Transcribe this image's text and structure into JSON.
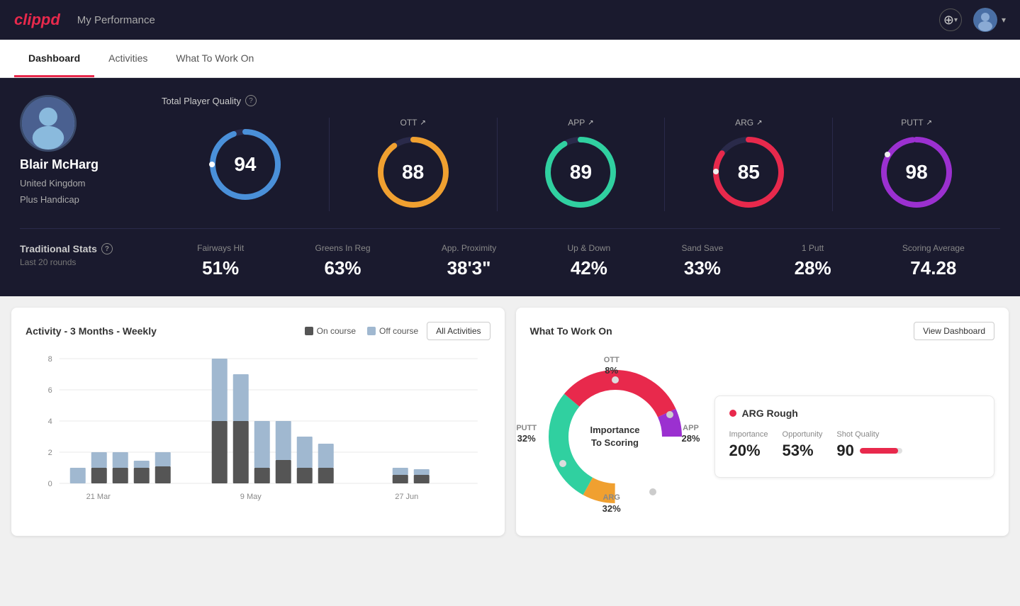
{
  "header": {
    "logo": "clippd",
    "title": "My Performance",
    "add_icon": "⊕",
    "chevron": "▾",
    "user_chevron": "▾"
  },
  "nav": {
    "tabs": [
      {
        "label": "Dashboard",
        "active": true
      },
      {
        "label": "Activities",
        "active": false
      },
      {
        "label": "What To Work On",
        "active": false
      }
    ]
  },
  "player": {
    "name": "Blair McHarg",
    "country": "United Kingdom",
    "handicap": "Plus Handicap"
  },
  "quality": {
    "section_label": "Total Player Quality",
    "total": {
      "value": "94",
      "color_start": "#4a90d9",
      "color_end": "#2a70b9"
    },
    "ott": {
      "label": "OTT",
      "value": "88",
      "color": "#f0a030"
    },
    "app": {
      "label": "APP",
      "value": "89",
      "color": "#30d0a0"
    },
    "arg": {
      "label": "ARG",
      "value": "85",
      "color": "#e8294c"
    },
    "putt": {
      "label": "PUTT",
      "value": "98",
      "color": "#9b30d0"
    }
  },
  "trad_stats": {
    "label": "Traditional Stats",
    "period": "Last 20 rounds",
    "metrics": [
      {
        "label": "Fairways Hit",
        "value": "51%"
      },
      {
        "label": "Greens In Reg",
        "value": "63%"
      },
      {
        "label": "App. Proximity",
        "value": "38'3\""
      },
      {
        "label": "Up & Down",
        "value": "42%"
      },
      {
        "label": "Sand Save",
        "value": "33%"
      },
      {
        "label": "1 Putt",
        "value": "28%"
      },
      {
        "label": "Scoring Average",
        "value": "74.28"
      }
    ]
  },
  "activity_chart": {
    "title": "Activity - 3 Months - Weekly",
    "legend": {
      "on_course": "On course",
      "off_course": "Off course"
    },
    "all_activities_btn": "All Activities",
    "x_labels": [
      "21 Mar",
      "9 May",
      "27 Jun"
    ],
    "y_labels": [
      "0",
      "2",
      "4",
      "6",
      "8"
    ]
  },
  "what_to_work_on": {
    "title": "What To Work On",
    "view_dashboard_btn": "View Dashboard",
    "donut_center_line1": "Importance",
    "donut_center_line2": "To Scoring",
    "segments": [
      {
        "label": "OTT",
        "pct": "8%",
        "color": "#f0a030"
      },
      {
        "label": "APP",
        "pct": "28%",
        "color": "#30d0a0"
      },
      {
        "label": "ARG",
        "pct": "32%",
        "color": "#e8294c"
      },
      {
        "label": "PUTT",
        "pct": "32%",
        "color": "#9b30d0"
      }
    ],
    "arg_card": {
      "title": "ARG Rough",
      "importance_label": "Importance",
      "importance_value": "20%",
      "opportunity_label": "Opportunity",
      "opportunity_value": "53%",
      "shot_quality_label": "Shot Quality",
      "shot_quality_value": "90",
      "shot_quality_bar_pct": 90
    }
  }
}
